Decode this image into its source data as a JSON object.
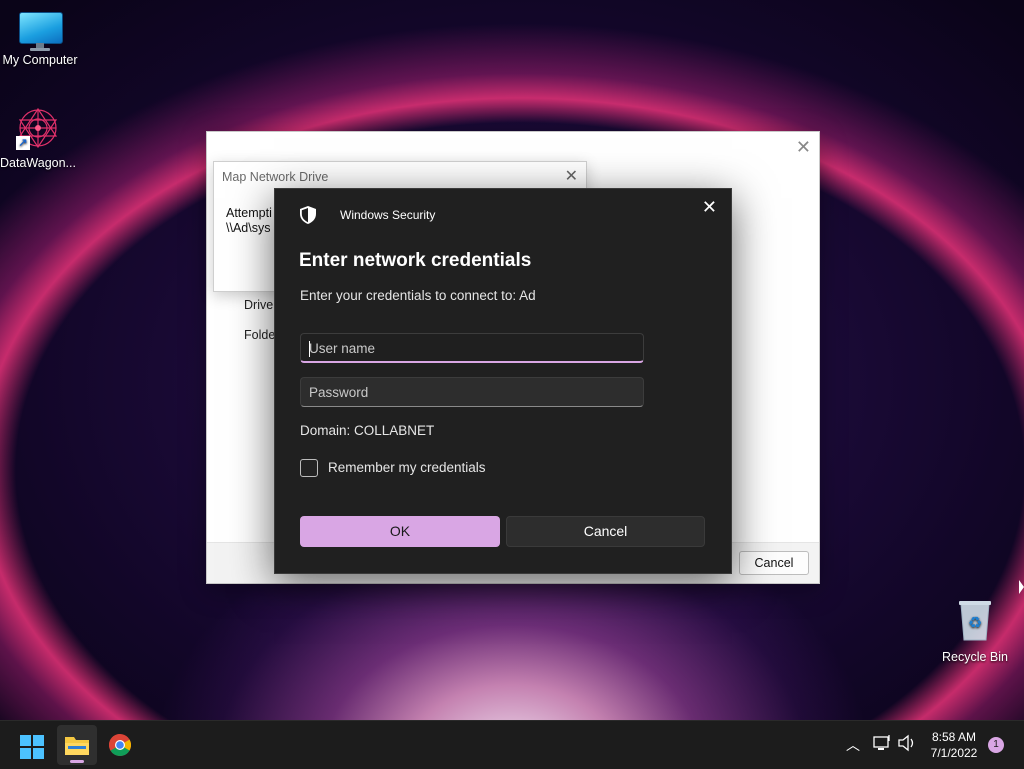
{
  "desktop": {
    "icons": [
      {
        "label": "My Computer",
        "icon": "monitor-icon"
      },
      {
        "label": "DataWagon...",
        "icon": "datawagon-icon"
      },
      {
        "label": "Recycle Bin",
        "icon": "recycle-bin-icon"
      }
    ]
  },
  "background_window": {
    "labels": {
      "drive": "Drive:",
      "folder": "Folde"
    },
    "cancel_label": "Cancel"
  },
  "map_dialog": {
    "title": "Map Network Drive",
    "line1": "Attempti",
    "line2": "\\\\Ad\\sys"
  },
  "security_dialog": {
    "app_title": "Windows Security",
    "heading": "Enter network credentials",
    "subtitle": "Enter your credentials to connect to: Ad",
    "username_placeholder": "User name",
    "username_value": "",
    "password_placeholder": "Password",
    "password_value": "",
    "domain": "Domain: COLLABNET",
    "remember_label": "Remember my credentials",
    "remember_checked": false,
    "ok_label": "OK",
    "cancel_label": "Cancel",
    "accent_color": "#d9a6e4"
  },
  "taskbar": {
    "apps": [
      {
        "name": "start",
        "icon": "windows-logo-icon"
      },
      {
        "name": "file-explorer",
        "icon": "folder-icon",
        "active": true
      },
      {
        "name": "chrome",
        "icon": "chrome-icon"
      }
    ],
    "time": "8:58 AM",
    "date": "7/1/2022",
    "notification_count": "1"
  }
}
